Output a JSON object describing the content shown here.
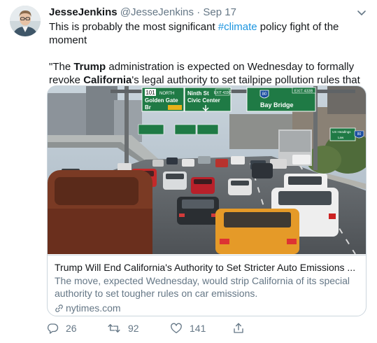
{
  "author": {
    "name": "JesseJenkins",
    "handle": "@JesseJenkins",
    "separator": "·",
    "date": "Sep 17"
  },
  "tweet": {
    "line1_before": "This is probably the most significant ",
    "hashtag": "#climate",
    "line1_after": " policy fight of the moment",
    "quote_open": "\"The ",
    "bold_trump": "Trump",
    "quote_mid1": " administration is expected on Wednesday to formally revoke ",
    "bold_california": "California",
    "quote_end": "'s legal authority to set tailpipe pollution rules that are stricter than federal rules.\""
  },
  "card": {
    "image_alt": "Freeway traffic under highway signs",
    "signs": {
      "sign1_route": "101",
      "sign1_dir": "NORTH",
      "sign1_line1": "Golden Gate",
      "sign1_line2": "Br",
      "sign2_line1": "Ninth St",
      "sign2_line2": "Civic Center",
      "sign2_exit": "EXIT 433C",
      "sign3_route": "80",
      "sign3_line": "Bay Bridge",
      "sign3_exit": "EXIT 433B",
      "sign4_line1": "US Headlngs",
      "sign4_line2": "Law",
      "sign4_route": "80"
    },
    "title": "Trump Will End California's Authority to Set Stricter Auto Emissions ...",
    "description": "The move, expected Wednesday, would strip California of its special authority to set tougher rules on car emissions.",
    "domain": "nytimes.com"
  },
  "actions": {
    "replies": "26",
    "retweets": "92",
    "likes": "141"
  },
  "colors": {
    "accent": "#1b95e0",
    "secondary_text": "#657786",
    "border": "#ccd6dd",
    "sign_green": "#1f7a45"
  }
}
